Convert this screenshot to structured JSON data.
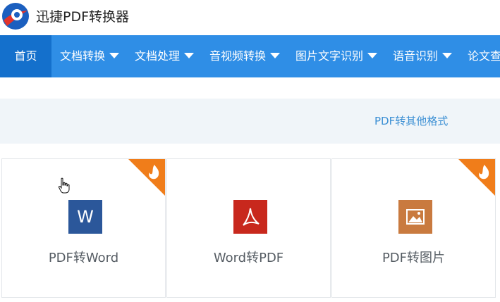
{
  "app": {
    "title": "迅捷PDF转换器"
  },
  "nav": {
    "items": [
      {
        "label": "首页",
        "has_dropdown": false,
        "active": true
      },
      {
        "label": "文档转换",
        "has_dropdown": true,
        "active": false
      },
      {
        "label": "文档处理",
        "has_dropdown": true,
        "active": false
      },
      {
        "label": "音视频转换",
        "has_dropdown": true,
        "active": false
      },
      {
        "label": "图片文字识别",
        "has_dropdown": true,
        "active": false
      },
      {
        "label": "语音识别",
        "has_dropdown": true,
        "active": false
      },
      {
        "label": "论文查",
        "has_dropdown": false,
        "active": false
      }
    ]
  },
  "subbar": {
    "link": "PDF转其他格式"
  },
  "cards": [
    {
      "label": "PDF转Word",
      "icon": "word-icon",
      "hot": true,
      "icon_color": "#2b579a"
    },
    {
      "label": "Word转PDF",
      "icon": "pdf-icon",
      "hot": false,
      "icon_color": "#c8281d"
    },
    {
      "label": "PDF转图片",
      "icon": "image-icon",
      "hot": true,
      "icon_color": "#c97a3f"
    }
  ],
  "colors": {
    "nav_bg": "#2f8ee6",
    "nav_active": "#1470cc",
    "hot_badge": "#f07d1a",
    "link": "#3b8fd4"
  }
}
